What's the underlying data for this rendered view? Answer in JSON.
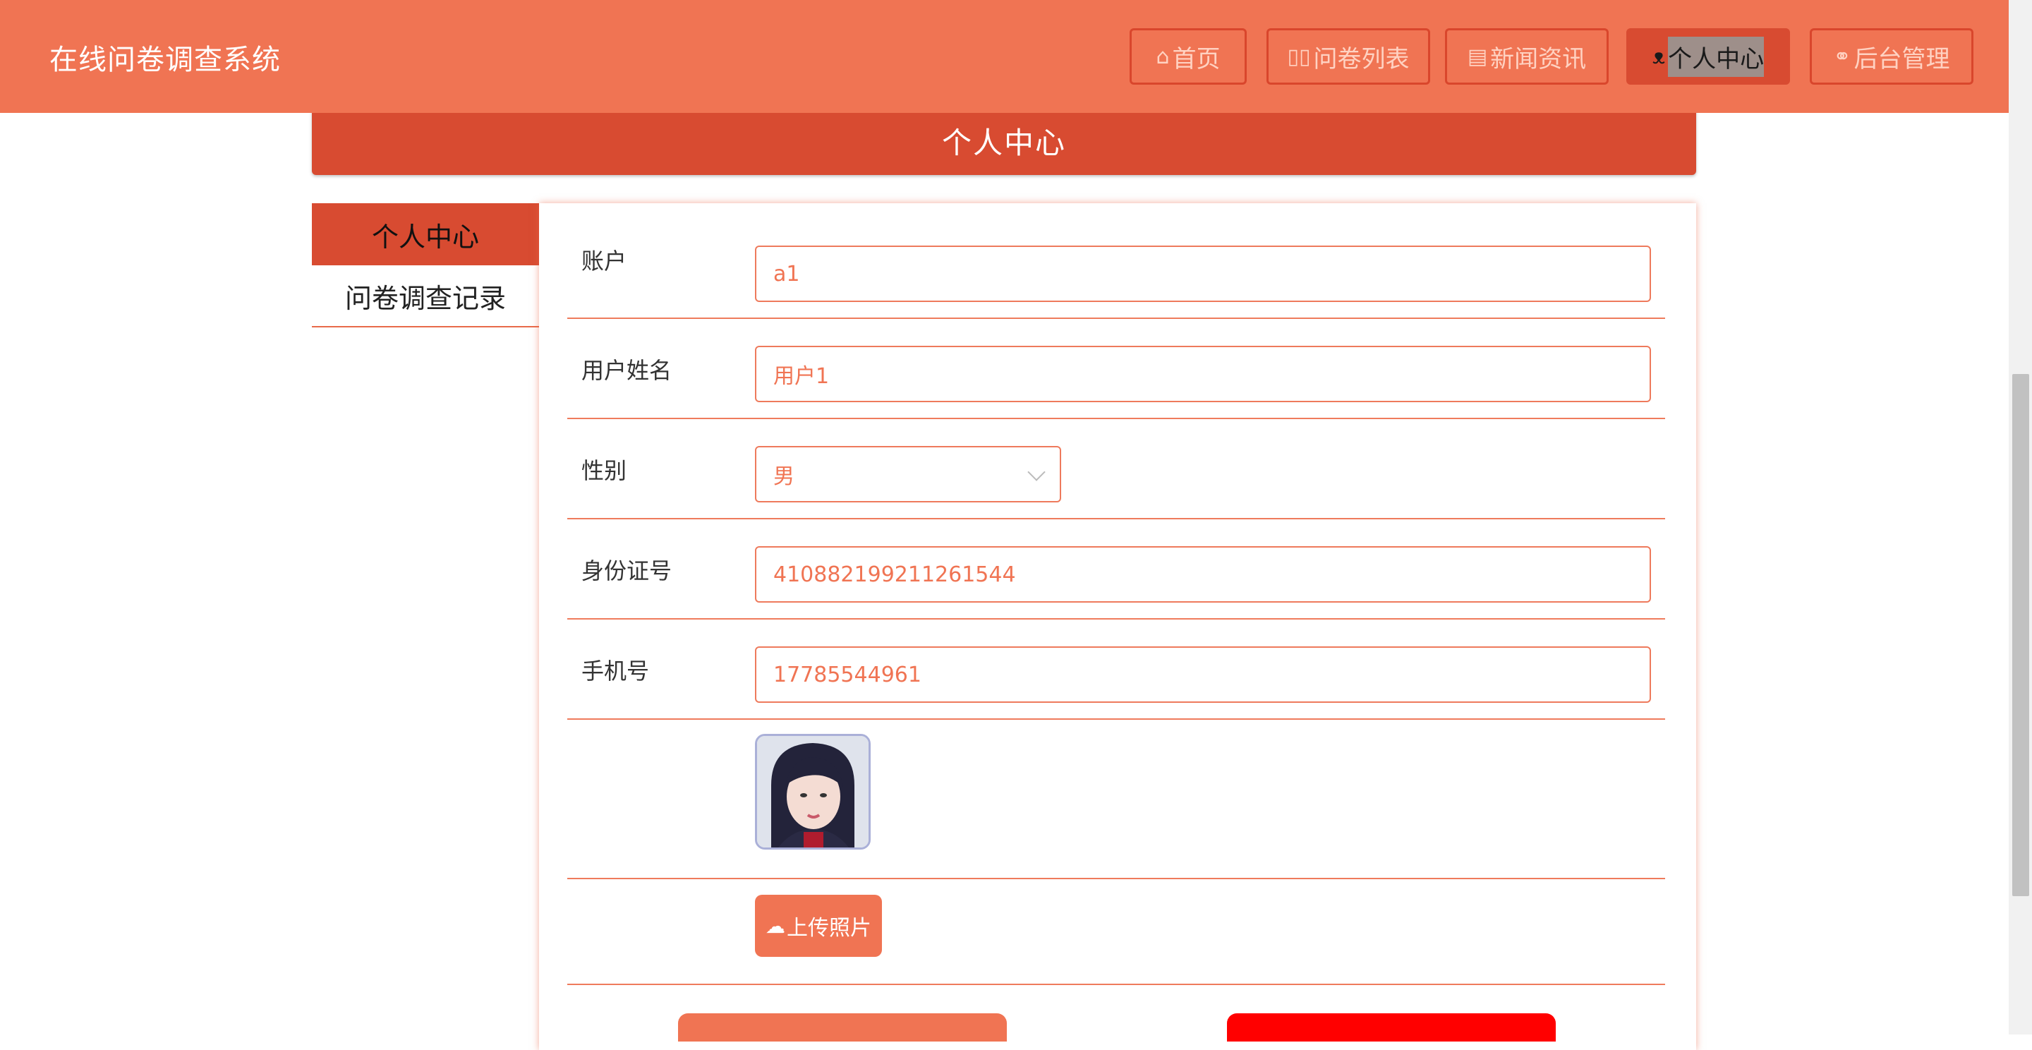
{
  "header": {
    "brand": "在线问卷调查系统",
    "nav": [
      {
        "icon": "⌂",
        "label": "首页"
      },
      {
        "icon": "▯▯",
        "label": "问卷列表"
      },
      {
        "icon": "▤",
        "label": "新闻资讯"
      },
      {
        "icon": "ᴥ",
        "label": "个人中心"
      },
      {
        "icon": "⚭",
        "label": "后台管理"
      }
    ]
  },
  "page_title": "个人中心",
  "side_menu": [
    "个人中心",
    "问卷调查记录"
  ],
  "form": {
    "account": {
      "label": "账户",
      "value": "a1"
    },
    "name": {
      "label": "用户姓名",
      "value": "用户1"
    },
    "gender": {
      "label": "性别",
      "value": "男"
    },
    "id_number": {
      "label": "身份证号",
      "value": "410882199211261544"
    },
    "phone": {
      "label": "手机号",
      "value": "17785544961"
    },
    "upload_label": "上传照片",
    "upload_icon": "☁"
  },
  "colors": {
    "primary": "#f07453",
    "dark": "#d84b31",
    "danger": "#ff0000"
  }
}
